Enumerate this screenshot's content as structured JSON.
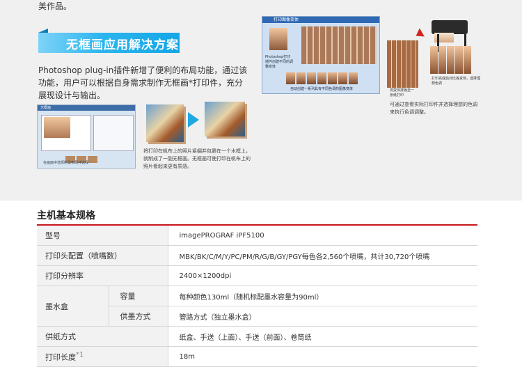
{
  "top_section": {
    "intro_tail": "美作品。",
    "banner_title": "无框画应用解决方案",
    "description": "Photoshop plug-in插件新增了便利的布局功能，通过该功能，用户可以根据自身需求制作无框画*打印件，充分展现设计与输出。",
    "caption_middle": "将打印在帆布上的照片紧绷并包裹在一个木框上，就制成了一副无框画。无框画可使打印在帆布上的照片看起来更有质感。",
    "caption_right": "可通过查看实际打印件并选择理想的色调来执行色调调整。",
    "screens": {
      "plugin_bar": "无框画",
      "plugin_panel_text": "Photoshop Plug-In 打印",
      "plugin_caption": "在画面中选择所需布局并选择",
      "grid_bar": "打印图像变体",
      "grid_side_label": "Photoshop打印插件创建不同的调整变体",
      "grid_caption": "自动创建一系列具有不同色调的图像变体",
      "sheet_caption": "将变体排版至一张纸打印",
      "strip_caption": "打印完成后对比各变体，选择理想色调"
    }
  },
  "specs": {
    "title": "主机基本规格",
    "footnote_mark": "*1",
    "rows": [
      {
        "label": "型号",
        "value": "imagePROGRAF iPF5100"
      },
      {
        "label": "打印头配置（喷嘴数）",
        "value": "MBK/BK/C/M/Y/PC/PM/R/G/B/GY/PGY每色各2,560个喷嘴，共计30,720个喷嘴"
      },
      {
        "label": "打印分辨率",
        "value": "2400×1200dpi"
      },
      {
        "label": "墨水盒",
        "sub_label": "容量",
        "value": "每种颜色130ml（随机标配墨水容量为90ml）"
      },
      {
        "label": "",
        "sub_label": "供墨方式",
        "value": "管路方式（独立墨水盒）"
      },
      {
        "label": "供纸方式",
        "value": "纸盒、手送（上面）、手送（前面）、卷筒纸"
      },
      {
        "label": "打印长度",
        "value": "18m"
      }
    ]
  },
  "colors": {
    "accent_blue": "#14a6e6",
    "rule_red": "#c8161d",
    "band_gray": "#f0f0f0"
  }
}
